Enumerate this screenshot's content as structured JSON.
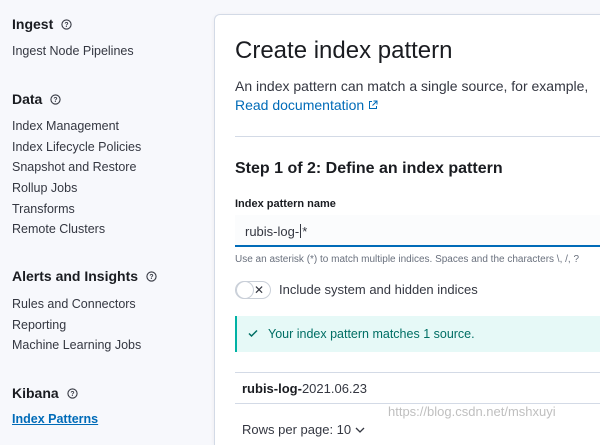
{
  "sidebar": {
    "sections": [
      {
        "title": "Ingest",
        "items": [
          "Ingest Node Pipelines"
        ]
      },
      {
        "title": "Data",
        "items": [
          "Index Management",
          "Index Lifecycle Policies",
          "Snapshot and Restore",
          "Rollup Jobs",
          "Transforms",
          "Remote Clusters"
        ]
      },
      {
        "title": "Alerts and Insights",
        "items": [
          "Rules and Connectors",
          "Reporting",
          "Machine Learning Jobs"
        ]
      },
      {
        "title": "Kibana",
        "items": [
          "Index Patterns"
        ]
      }
    ],
    "active_item": "Index Patterns"
  },
  "main": {
    "title": "Create index pattern",
    "description": "An index pattern can match a single source, for example,",
    "doc_link": "Read documentation",
    "step_title": "Step 1 of 2: Define an index pattern",
    "field_label": "Index pattern name",
    "field_value_before_caret": "rubis-log-",
    "field_value_after_caret": "*",
    "help_text": "Use an asterisk (*) to match multiple indices. Spaces and the characters \\, /, ?",
    "toggle_label": "Include system and hidden indices",
    "toggle_on": false,
    "callout_text": "Your index pattern matches 1 source.",
    "result_bold": "rubis-log-",
    "result_rest": "2021.06.23",
    "rows_per_page": "Rows per page: 10"
  },
  "watermark": "https://blog.csdn.net/mshxuyi",
  "colors": {
    "accent": "#006bb8",
    "success": "#006e64",
    "success_border": "#01b2a5"
  },
  "icons": [
    "help-icon",
    "external-link-icon",
    "close-icon",
    "check-icon",
    "chevron-down-icon"
  ]
}
